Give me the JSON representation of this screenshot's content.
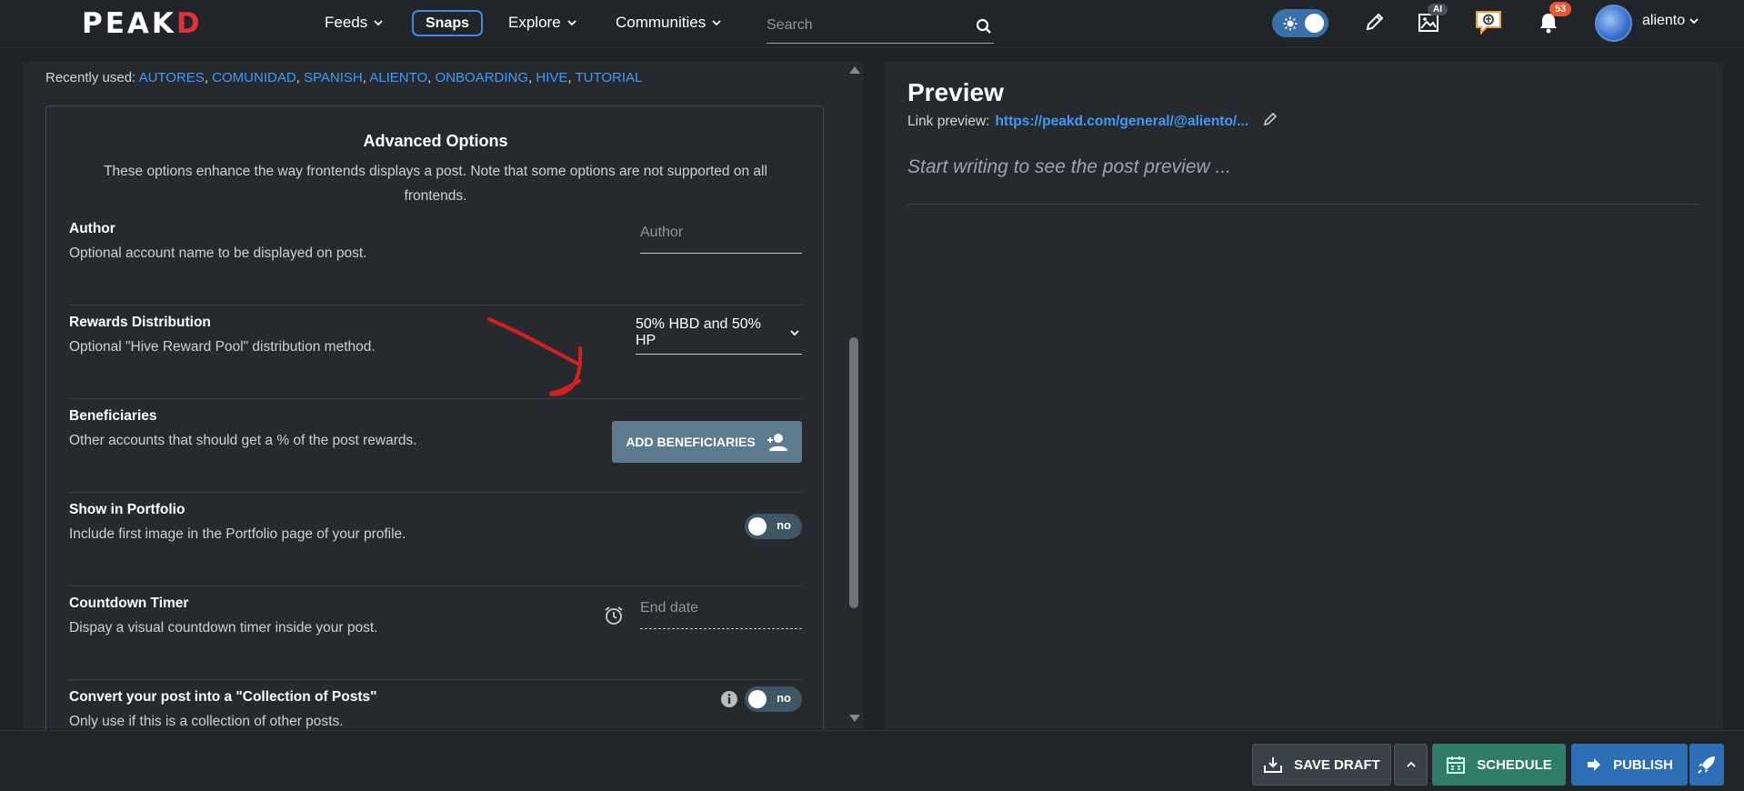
{
  "header": {
    "logo": {
      "main": "PEAK",
      "accent": "D"
    },
    "nav": [
      {
        "label": "Feeds"
      },
      {
        "label": "Explore"
      },
      {
        "label": "Communities"
      }
    ],
    "snaps_label": "Snaps",
    "search_placeholder": "Search",
    "notifications_count": "53",
    "ai_badge": "AI",
    "username": "aliento"
  },
  "editor": {
    "recently_used_label": "Recently used:",
    "recent_tags": [
      "AUTORES",
      "COMUNIDAD",
      "SPANISH",
      "ALIENTO",
      "ONBOARDING",
      "HIVE",
      "TUTORIAL"
    ],
    "advanced": {
      "title": "Advanced Options",
      "description": "These options enhance the way frontends displays a post. Note that some options are not supported on all frontends.",
      "options": [
        {
          "title": "Author",
          "desc": "Optional account name to be displayed on post.",
          "placeholder": "Author"
        },
        {
          "title": "Rewards Distribution",
          "desc": "Optional \"Hive Reward Pool\" distribution method.",
          "value": "50% HBD and 50% HP"
        },
        {
          "title": "Beneficiaries",
          "desc": "Other accounts that should get a % of the post rewards.",
          "button": "ADD BENEFICIARIES"
        },
        {
          "title": "Show in Portfolio",
          "desc": "Include first image in the Portfolio page of your profile.",
          "toggle": "no"
        },
        {
          "title": "Countdown Timer",
          "desc": "Dispay a visual countdown timer inside your post.",
          "placeholder": "End date"
        },
        {
          "title": "Convert your post into a \"Collection of Posts\"",
          "desc": "Only use if this is a collection of other posts.",
          "toggle": "no"
        }
      ]
    }
  },
  "preview": {
    "title": "Preview",
    "link_label": "Link preview:",
    "link_url": "https://peakd.com/general/@aliento/...",
    "empty_text": "Start writing to see the post preview ..."
  },
  "footer": {
    "save_draft": "SAVE DRAFT",
    "schedule": "SCHEDULE",
    "publish": "PUBLISH"
  },
  "colors": {
    "accent_blue": "#3f9af5",
    "brand_red": "#e0313a",
    "schedule_green": "#2f7d69",
    "publish_blue": "#2d6fb7",
    "annotation_red": "#d42020"
  }
}
